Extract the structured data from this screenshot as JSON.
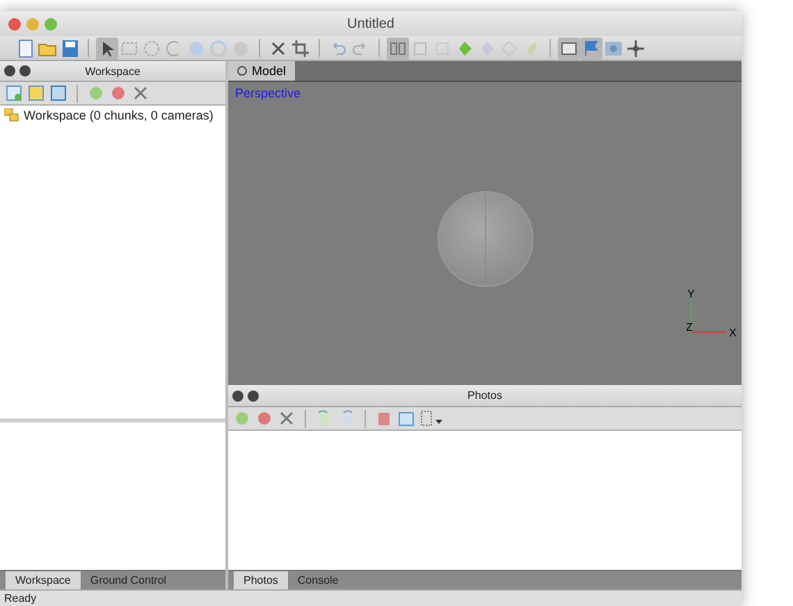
{
  "window": {
    "title": "Untitled"
  },
  "toolbar": {
    "groups": [
      [
        {
          "selected": false
        },
        {
          "selected": false
        },
        {
          "selected": false
        }
      ],
      [
        {
          "selected": true
        },
        {
          "selected": false
        },
        {
          "selected": false
        },
        {
          "selected": false
        },
        {
          "selected": false
        },
        {
          "selected": false
        },
        {
          "selected": false
        }
      ],
      [
        {
          "selected": false
        },
        {
          "selected": false
        }
      ],
      [
        {
          "selected": false
        },
        {
          "selected": false
        }
      ],
      [
        {
          "selected": true
        },
        {
          "selected": false
        },
        {
          "selected": false
        },
        {
          "selected": false
        },
        {
          "selected": false
        },
        {
          "selected": false
        },
        {
          "selected": false
        }
      ],
      [
        {
          "selected": true
        },
        {
          "selected": true
        },
        {
          "selected": false
        },
        {
          "selected": false
        }
      ]
    ]
  },
  "workspace_panel": {
    "title": "Workspace",
    "tree": [
      {
        "label": "Workspace (0 chunks, 0 cameras)"
      }
    ]
  },
  "left_tabs": [
    {
      "label": "Workspace",
      "selected": true
    },
    {
      "label": "Ground Control",
      "selected": false
    }
  ],
  "model_tabs": [
    {
      "label": "Model",
      "selected": true
    }
  ],
  "viewport": {
    "mode": "Perspective",
    "axes": [
      "Y",
      "Z",
      "X"
    ]
  },
  "photos_panel": {
    "title": "Photos"
  },
  "right_tabs": [
    {
      "label": "Photos",
      "selected": true
    },
    {
      "label": "Console",
      "selected": false
    }
  ],
  "status_bar": "Ready"
}
